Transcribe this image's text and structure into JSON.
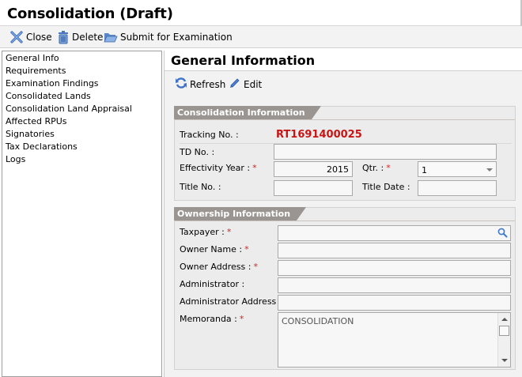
{
  "window": {
    "title": "Consolidation (Draft)"
  },
  "toolbar": {
    "close": {
      "label": "Close",
      "icon": "close-icon"
    },
    "delete": {
      "label": "Delete",
      "icon": "trash-icon"
    },
    "submit": {
      "label": "Submit for Examination",
      "icon": "folder-open-icon"
    }
  },
  "sidebar": {
    "items": [
      {
        "label": "General Info"
      },
      {
        "label": "Requirements"
      },
      {
        "label": "Examination Findings"
      },
      {
        "label": "Consolidated Lands"
      },
      {
        "label": "Consolidation Land Appraisal"
      },
      {
        "label": "Affected RPUs"
      },
      {
        "label": "Signatories"
      },
      {
        "label": "Tax Declarations"
      },
      {
        "label": "Logs"
      }
    ]
  },
  "main": {
    "heading": "General Information",
    "actions": {
      "refresh": {
        "label": "Refresh",
        "icon": "refresh-icon"
      },
      "edit": {
        "label": "Edit",
        "icon": "pencil-icon"
      }
    }
  },
  "consolidation": {
    "section_title": "Consolidation Information",
    "tracking_label": "Tracking No. :",
    "tracking_value": "RT1691400025",
    "td_label": "TD No. :",
    "td_value": "",
    "effectivity_label": "Effectivity Year :",
    "effectivity_value": "2015",
    "qtr_label": "Qtr. :",
    "qtr_value": "1",
    "title_label": "Title No. :",
    "title_value": "",
    "title_date_label": "Title Date :",
    "title_date_value": ""
  },
  "ownership": {
    "section_title": "Ownership Information",
    "taxpayer_label": "Taxpayer :",
    "taxpayer_value": "",
    "owner_name_label": "Owner Name :",
    "owner_name_value": "",
    "owner_address_label": "Owner Address :",
    "owner_address_value": "",
    "administrator_label": "Administrator :",
    "administrator_value": "",
    "admin_address_label": "Administrator Address :",
    "admin_address_value": "",
    "memoranda_label": "Memoranda :",
    "memoranda_value": "CONSOLIDATION"
  },
  "required_mark": "*",
  "colors": {
    "tracking": "#c81414",
    "required": "#e0201f",
    "section_tab": "#9a9590"
  }
}
